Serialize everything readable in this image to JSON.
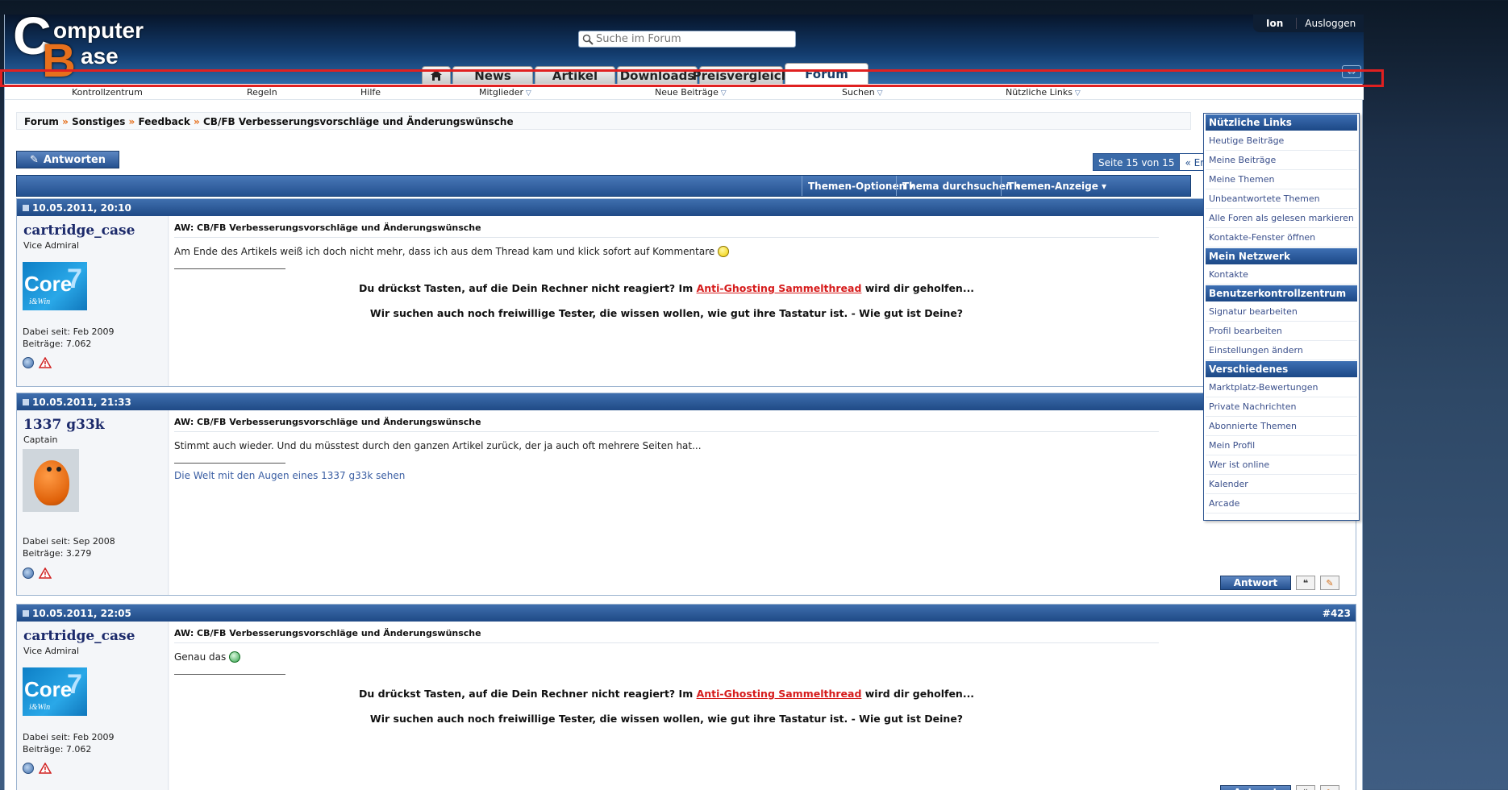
{
  "header": {
    "logo_line1": "omputer",
    "logo_line2": "ase",
    "logo_c": "C",
    "logo_b": "B",
    "search_placeholder": "Suche im Forum",
    "user": "Ion",
    "logout": "Ausloggen"
  },
  "nav_tabs": [
    {
      "label": "",
      "icon": "home-icon"
    },
    {
      "label": "News"
    },
    {
      "label": "Artikel"
    },
    {
      "label": "Downloads"
    },
    {
      "label": "Preisvergleich"
    },
    {
      "label": "Forum",
      "active": true
    }
  ],
  "subnav": [
    {
      "label": "Kontrollzentrum"
    },
    {
      "label": "Regeln"
    },
    {
      "label": "Hilfe"
    },
    {
      "label": "Mitglieder",
      "dropdown": true
    },
    {
      "label": "Neue Beiträge",
      "dropdown": true
    },
    {
      "label": "Suchen",
      "dropdown": true
    },
    {
      "label": "Nützliche Links",
      "dropdown": true
    }
  ],
  "breadcrumb": [
    "Forum",
    "Sonstiges",
    "Feedback",
    "CB/FB Verbesserungsvorschläge und Änderungswünsche"
  ],
  "breadcrumb_sep": "»",
  "reply_button": "Antworten",
  "pagination": {
    "label": "Seite 15 von 15",
    "first": "« Erste"
  },
  "thread_tools": [
    "Themen-Optionen ▾",
    "Thema durchsuchen ▾",
    "Themen-Anzeige ▾"
  ],
  "posts": [
    {
      "date": "10.05.2011, 20:10",
      "number": "",
      "user": "cartridge_case",
      "rank": "Vice Admiral",
      "avatar": "core7",
      "joined": "Dabei seit: Feb 2009",
      "posts": "Beiträge: 7.062",
      "title": "AW: CB/FB Verbesserungsvorschläge und Änderungswünsche",
      "text": "Am Ende des Artikels weiß ich doch nicht mehr, dass ich aus dem Thread kam und klick sofort auf Kommentare",
      "smiley": "yellow",
      "sig_pre": "Du drückst Tasten, auf die Dein Rechner nicht reagiert? Im ",
      "sig_link": "Anti-Ghosting Sammelthread",
      "sig_post": " wird dir geholfen...",
      "sig2": "Wir suchen auch noch freiwillige Tester, die wissen wollen, wie gut ihre Tastatur ist. - Wie gut ist Deine?"
    },
    {
      "date": "10.05.2011, 21:33",
      "number": "",
      "user": "1337 g33k",
      "rank": "Captain",
      "avatar": "figure",
      "joined": "Dabei seit: Sep 2008",
      "posts": "Beiträge: 3.279",
      "title": "AW: CB/FB Verbesserungsvorschläge und Änderungswünsche",
      "text": "Stimmt auch wieder. Und du müsstest durch den ganzen Artikel zurück, der ja auch oft mehrere Seiten hat...",
      "signature": "Die Welt mit den Augen eines 1337 g33k sehen",
      "reply": "Antwort"
    },
    {
      "date": "10.05.2011, 22:05",
      "number": "#423",
      "user": "cartridge_case",
      "rank": "Vice Admiral",
      "avatar": "core7",
      "joined": "Dabei seit: Feb 2009",
      "posts": "Beiträge: 7.062",
      "title": "AW: CB/FB Verbesserungsvorschläge und Änderungswünsche",
      "text": "Genau das",
      "smiley": "green",
      "sig_pre": "Du drückst Tasten, auf die Dein Rechner nicht reagiert? Im ",
      "sig_link": "Anti-Ghosting Sammelthread",
      "sig_post": " wird dir geholfen...",
      "sig2": "Wir suchen auch noch freiwillige Tester, die wissen wollen, wie gut ihre Tastatur ist. - Wie gut ist Deine?",
      "reply": "Antwort"
    }
  ],
  "avatar_core": {
    "word": "Core",
    "digit": "7",
    "sub": "i&Win"
  },
  "dropdown": [
    {
      "type": "head",
      "label": "Nützliche Links"
    },
    {
      "type": "item",
      "label": "Heutige Beiträge"
    },
    {
      "type": "item",
      "label": "Meine Beiträge"
    },
    {
      "type": "item",
      "label": "Meine Themen"
    },
    {
      "type": "item",
      "label": "Unbeantwortete Themen"
    },
    {
      "type": "item",
      "label": "Alle Foren als gelesen markieren"
    },
    {
      "type": "item",
      "label": "Kontakte-Fenster öffnen"
    },
    {
      "type": "head",
      "label": "Mein Netzwerk"
    },
    {
      "type": "item",
      "label": "Kontakte"
    },
    {
      "type": "head",
      "label": "Benutzerkontrollzentrum"
    },
    {
      "type": "item",
      "label": "Signatur bearbeiten"
    },
    {
      "type": "item",
      "label": "Profil bearbeiten"
    },
    {
      "type": "item",
      "label": "Einstellungen ändern"
    },
    {
      "type": "head",
      "label": "Verschiedenes"
    },
    {
      "type": "item",
      "label": "Marktplatz-Bewertungen"
    },
    {
      "type": "item",
      "label": "Private Nachrichten"
    },
    {
      "type": "item",
      "label": "Abonnierte Themen"
    },
    {
      "type": "item",
      "label": "Mein Profil"
    },
    {
      "type": "item",
      "label": "Wer ist online"
    },
    {
      "type": "item",
      "label": "Kalender"
    },
    {
      "type": "item",
      "label": "Arcade"
    }
  ],
  "colors": {
    "accent": "#24508f",
    "link_red": "#d61c1c",
    "highlight": "#e02020",
    "logo_orange": "#e7701c"
  }
}
